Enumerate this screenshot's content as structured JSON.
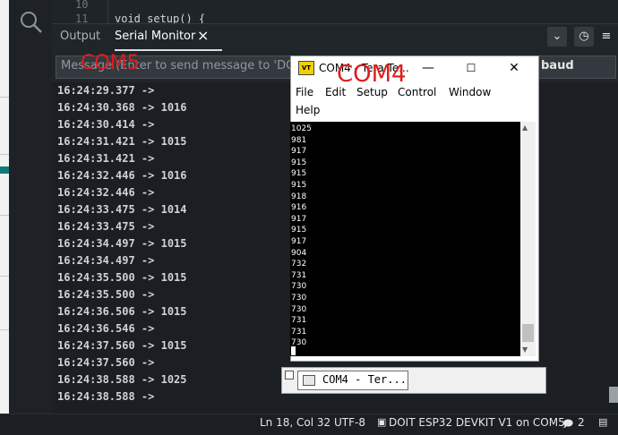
{
  "editor": {
    "line_prev": "10",
    "line_num": "11",
    "code_line": "void setup() {"
  },
  "panel": {
    "tabs": [
      "Output",
      "Serial Monitor"
    ],
    "close_glyph": "×"
  },
  "message": {
    "placeholder": "Message (Enter to send message to 'DOIT",
    "port_annotation": "COM5"
  },
  "baud": {
    "label": "baud"
  },
  "serial_output": [
    "16:24:29.377 ->",
    "16:24:30.368 -> 1016",
    "16:24:30.414 ->",
    "16:24:31.421 -> 1015",
    "16:24:31.421 ->",
    "16:24:32.446 -> 1016",
    "16:24:32.446 ->",
    "16:24:33.475 -> 1014",
    "16:24:33.475 ->",
    "16:24:34.497 -> 1015",
    "16:24:34.497 ->",
    "16:24:35.500 -> 1015",
    "16:24:35.500 ->",
    "16:24:36.506 -> 1015",
    "16:24:36.546 ->",
    "16:24:37.560 -> 1015",
    "16:24:37.560 ->",
    "16:24:38.588 -> 1025",
    "16:24:38.588 ->"
  ],
  "teraterm": {
    "title": "COM4 - Tera Te...",
    "port_annotation": "COM4",
    "menu": [
      "File",
      "Edit",
      "Setup",
      "Control",
      "Window",
      "Help"
    ],
    "values": [
      "1025",
      "981",
      "917",
      "915",
      "915",
      "915",
      "918",
      "916",
      "917",
      "915",
      "917",
      "904",
      "732",
      "731",
      "730",
      "730",
      "730",
      "731",
      "731",
      "730"
    ]
  },
  "taskbar": {
    "label": "COM4 - Ter..."
  },
  "statusbar": {
    "position": "Ln 18, Col 32",
    "encoding": "UTF-8",
    "board": "DOIT ESP32 DEVKIT V1 on COM5",
    "notifications": "2"
  }
}
